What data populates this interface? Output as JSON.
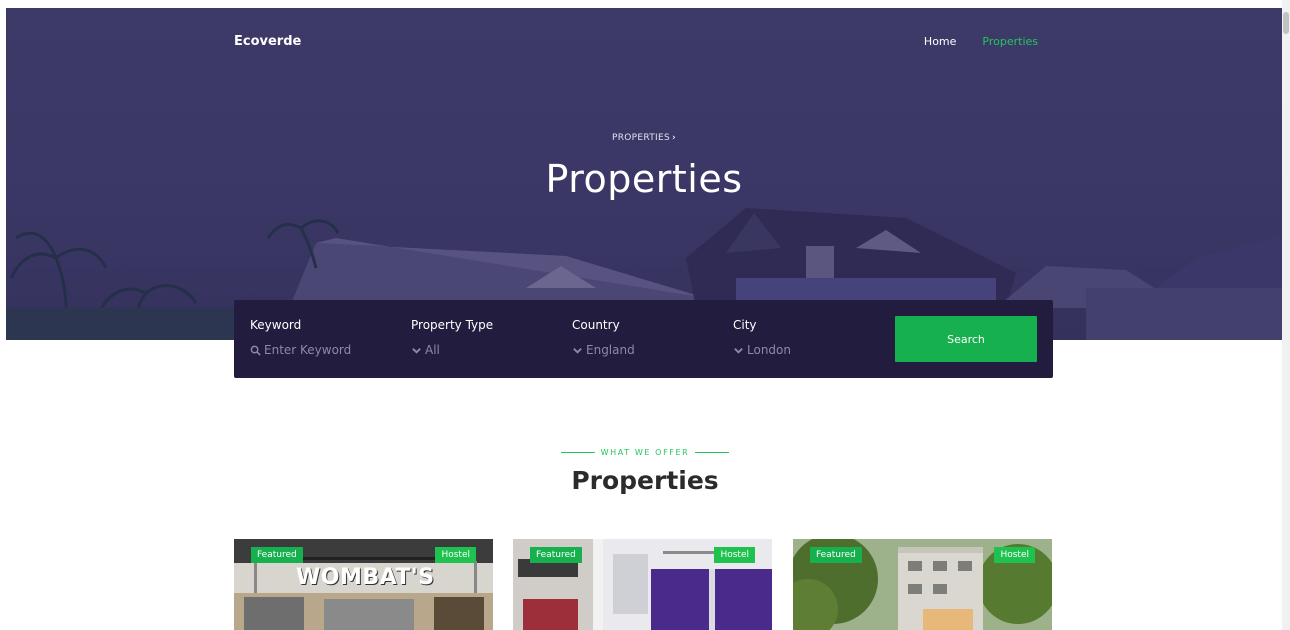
{
  "brand": "Ecoverde",
  "nav": {
    "home": "Home",
    "properties": "Properties"
  },
  "hero": {
    "breadcrumb": "PROPERTIES",
    "title": "Properties"
  },
  "search": {
    "fields": [
      {
        "label": "Keyword",
        "value": "Enter Keyword",
        "icon": "search-icon"
      },
      {
        "label": "Property Type",
        "value": "All",
        "icon": "chevron-down-icon"
      },
      {
        "label": "Country",
        "value": "England",
        "icon": "chevron-down-icon"
      },
      {
        "label": "City",
        "value": "London",
        "icon": "chevron-down-icon"
      }
    ],
    "button": "Search"
  },
  "section": {
    "eyebrow": "WHAT WE OFFER",
    "title": "Properties"
  },
  "cards": [
    {
      "featured": "Featured",
      "type": "Hostel",
      "sign": "WOMBAT'S"
    },
    {
      "featured": "Featured",
      "type": "Hostel"
    },
    {
      "featured": "Featured",
      "type": "Hostel"
    }
  ],
  "colors": {
    "accent": "#16b04e",
    "search_bg": "#221c3e",
    "hero_overlay": "#3b3766"
  }
}
